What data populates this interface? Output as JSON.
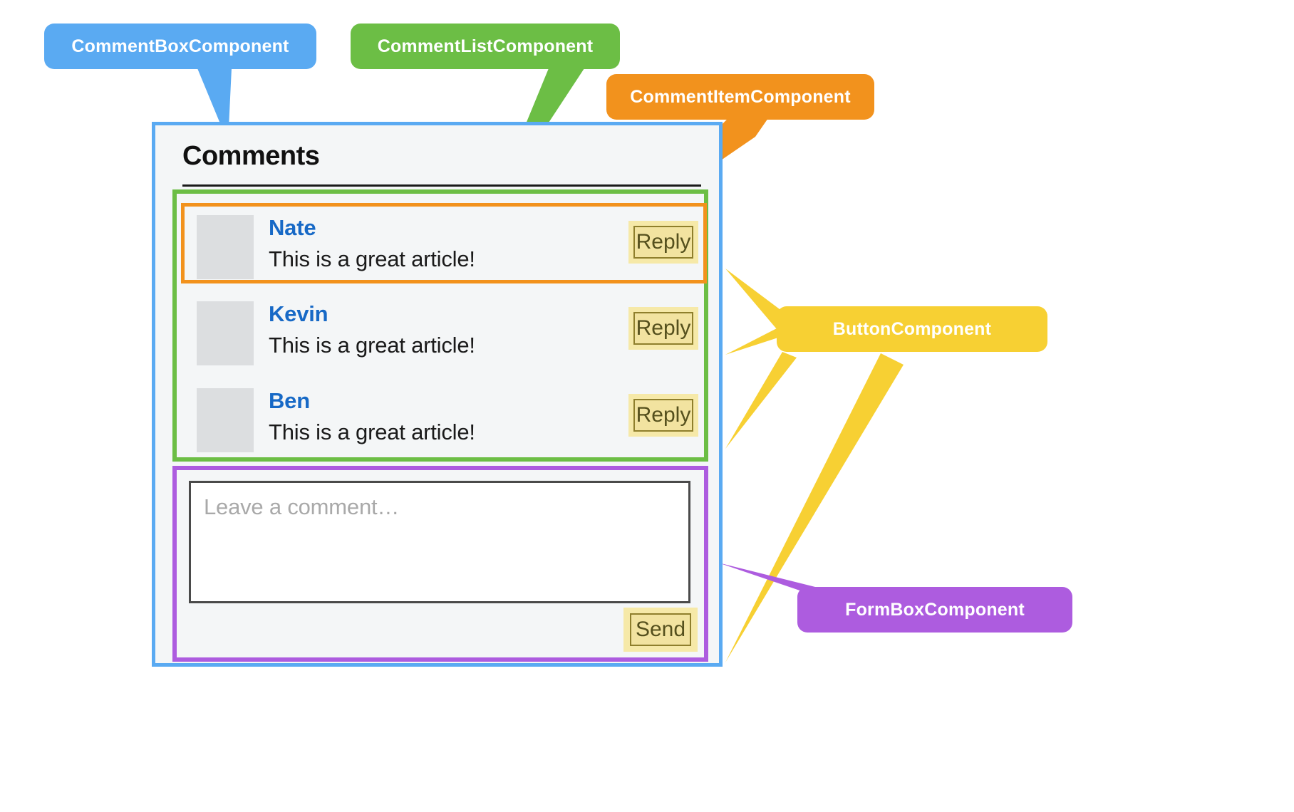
{
  "annotations": [
    {
      "id": "commentbox",
      "label": "CommentBoxComponent",
      "color": "#5aaaf2"
    },
    {
      "id": "commentlist",
      "label": "CommentListComponent",
      "color": "#6cbe45"
    },
    {
      "id": "commentitem",
      "label": "CommentItemComponent",
      "color": "#f2921d"
    },
    {
      "id": "button",
      "label": "ButtonComponent",
      "color": "#f7d033"
    },
    {
      "id": "formbox",
      "label": "FormBoxComponent",
      "color": "#ad5cdf"
    }
  ],
  "comment_box": {
    "heading": "Comments",
    "border_color": "#5aaaf2",
    "background": "#f4f6f7"
  },
  "comment_list": {
    "border_color": "#6cbe45",
    "items": [
      {
        "author": "Nate",
        "text": "This is a great article!",
        "reply_label": "Reply",
        "highlighted": true
      },
      {
        "author": "Kevin",
        "text": "This is a great article!",
        "reply_label": "Reply",
        "highlighted": false
      },
      {
        "author": "Ben",
        "text": "This is a great article!",
        "reply_label": "Reply",
        "highlighted": false
      }
    ]
  },
  "form_box": {
    "border_color": "#ad5cdf",
    "textarea_placeholder": "Leave a comment…",
    "textarea_value": "",
    "send_label": "Send"
  }
}
